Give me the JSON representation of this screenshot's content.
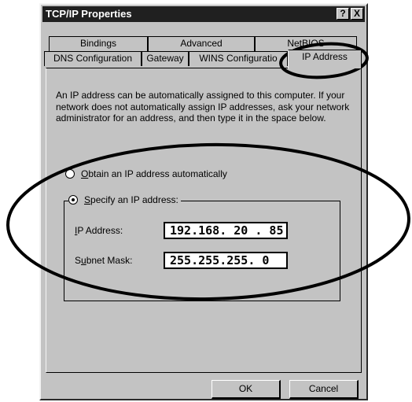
{
  "window": {
    "title": "TCP/IP Properties",
    "help_label": "?",
    "close_label": "X"
  },
  "tabs": {
    "row1": [
      "Bindings",
      "Advanced",
      "NetBIOS"
    ],
    "row2": [
      "DNS Configuration",
      "Gateway",
      "WINS Configuratio",
      "IP Address"
    ],
    "active": "IP Address"
  },
  "ip_page": {
    "description": "An IP address can be automatically assigned to this computer. If your network does not automatically assign IP addresses, ask your network administrator for an address, and then type it in the space below.",
    "obtain": {
      "hotkey": "O",
      "rest": "btain an IP address automatically",
      "selected": false
    },
    "specify": {
      "hotkey": "S",
      "rest": "pecify an IP address:",
      "selected": true
    },
    "ip_label": {
      "hotkey": "I",
      "rest": "P Address:"
    },
    "ip_value": "192.168. 20 . 85",
    "subnet_label": {
      "before": "S",
      "hotkey": "u",
      "rest": "bnet Mask:"
    },
    "subnet_value": "255.255.255. 0"
  },
  "buttons": {
    "ok": "OK",
    "cancel": "Cancel"
  },
  "annotations": {
    "color": "#000000"
  }
}
